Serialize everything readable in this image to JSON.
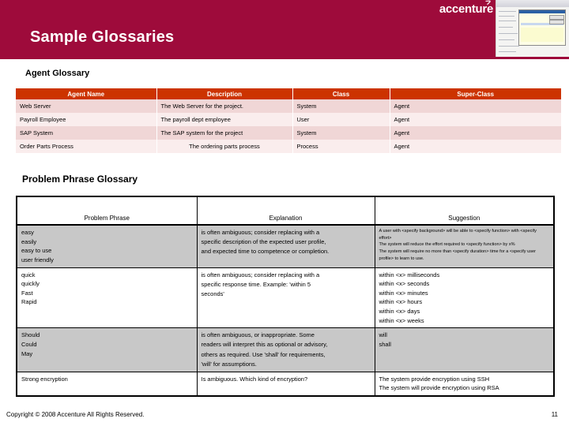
{
  "header": {
    "title": "Sample Glossaries",
    "brand": "accenture",
    "brand_accent_color": "#9e0b3b",
    "thumbnail_name": "screenshot-thumbnail"
  },
  "sections": {
    "agent_glossary": {
      "heading": "Agent Glossary",
      "header_color": "#cc3300",
      "columns": [
        "Agent Name",
        "Description",
        "Class",
        "Super-Class"
      ],
      "rows": [
        [
          "Web Server",
          "The Web Server for the project.",
          "System",
          "Agent"
        ],
        [
          "Payroll Employee",
          "The payroll dept employee",
          "User",
          "Agent"
        ],
        [
          "SAP System",
          "The SAP system for the project",
          "System",
          "Agent"
        ],
        [
          "Order Parts Process",
          "The ordering parts process",
          "Process",
          "Agent"
        ]
      ]
    },
    "problem_phrase_glossary": {
      "heading": "Problem Phrase Glossary",
      "columns": [
        "Problem Phrase",
        "Explanation",
        "Suggestion"
      ],
      "rows": [
        {
          "shaded": true,
          "phrases": [
            "easy",
            "easily",
            "easy to use",
            "user friendly"
          ],
          "explanation": [
            "is often ambiguous; consider replacing with a",
            "specific description of the expected user profile,",
            "and expected time to competence or completion."
          ],
          "suggestions": [
            "A user with <specify background> will be able to <specify function> with <specify effort>",
            "The system will reduce the effort required to <specify function> by x%",
            "The system will require no more than <specify duration> time for a <specify user profile> to learn to use."
          ]
        },
        {
          "shaded": false,
          "phrases": [
            "quick",
            "quickly",
            "Fast",
            "Rapid"
          ],
          "explanation": [
            "is often ambiguous; consider replacing with a",
            "specific response time. Example: 'within 5",
            "seconds'"
          ],
          "suggestions": [
            "within <x> milliseconds",
            "within <x> seconds",
            "within <x> minutes",
            "within <x> hours",
            "within <x> days",
            "within <x> weeks"
          ]
        },
        {
          "shaded": true,
          "phrases": [
            "Should",
            "Could",
            "May"
          ],
          "explanation": [
            "is often ambiguous, or inappropriate. Some",
            "readers will interpret this as optional or advisory,",
            "others as required. Use 'shall' for requirements,",
            "'will' for assumptions."
          ],
          "suggestions": [
            "will",
            "shall"
          ]
        },
        {
          "shaded": false,
          "phrases": [
            "Strong encryption"
          ],
          "explanation": [
            "Is ambiguous.  Which kind of encryption?"
          ],
          "suggestions": [
            "The system provide encryption using SSH",
            "The system will provide encryption using RSA"
          ]
        }
      ]
    }
  },
  "footer": {
    "copyright": "Copyright © 2008 Accenture All Rights Reserved.",
    "page_number": "11"
  }
}
